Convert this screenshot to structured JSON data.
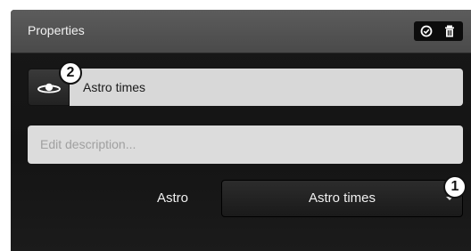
{
  "header": {
    "title": "Properties",
    "tools": [
      {
        "icon": "check-circle-icon"
      },
      {
        "icon": "trash-icon"
      }
    ]
  },
  "name_row": {
    "icon": "orbit-icon",
    "value": "Astro times"
  },
  "description": {
    "placeholder": "Edit description..."
  },
  "astro_field": {
    "label": "Astro",
    "selected": "Astro times"
  },
  "callouts": [
    "1",
    "2"
  ],
  "colors": {
    "header_bg": "#555555",
    "panel_bg": "#161616",
    "field_bg": "#d8d8d8",
    "badge_bg": "#ffffff"
  }
}
